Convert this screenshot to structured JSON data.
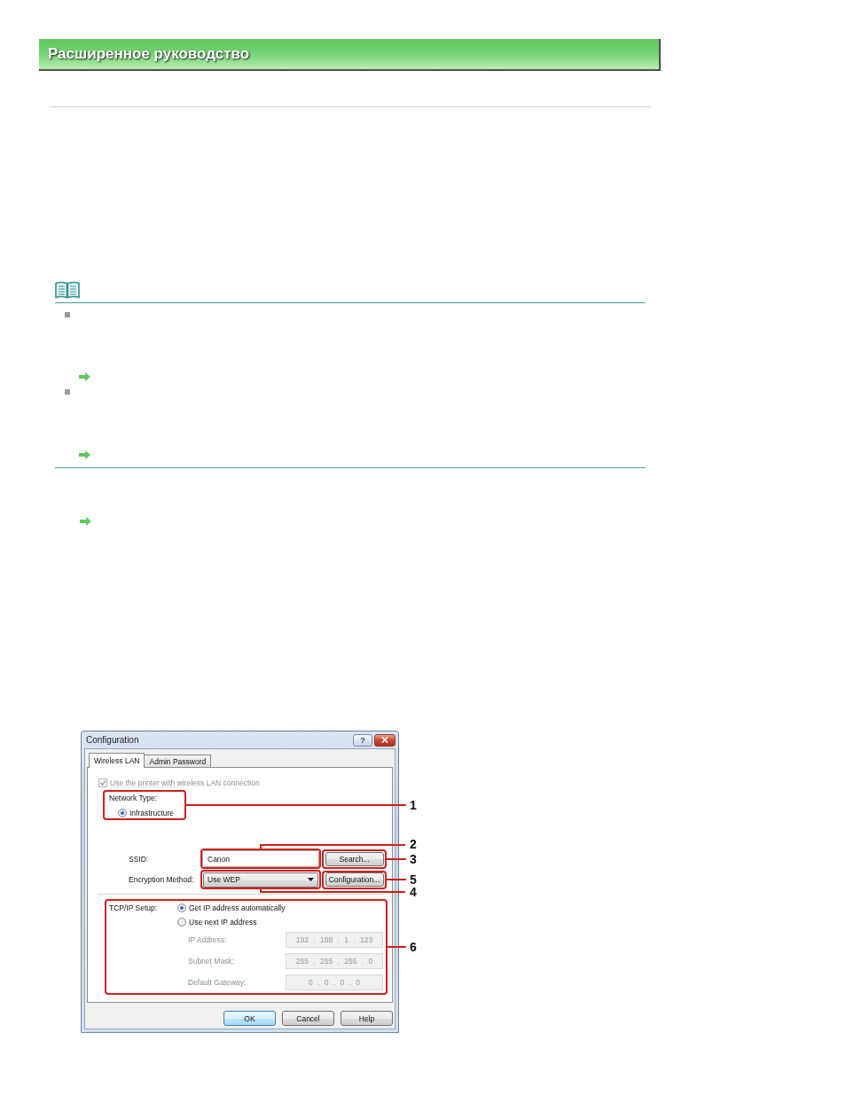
{
  "header": {
    "title": "Расширенное руководство"
  },
  "dialog": {
    "title": "Configuration",
    "help_button": "?",
    "tabs": [
      {
        "label": "Wireless LAN",
        "selected": true
      },
      {
        "label": "Admin Password",
        "selected": false
      }
    ],
    "wireless_checkbox": {
      "label": "Use the printer with wireless LAN connection",
      "checked": true,
      "disabled": true
    },
    "network_type": {
      "label": "Network Type:",
      "options": [
        {
          "label": "Infrastructure",
          "selected": true
        }
      ]
    },
    "ssid": {
      "label": "SSID:",
      "value": "Canon",
      "button": "Search..."
    },
    "encryption": {
      "label": "Encryption Method:",
      "value": "Use WEP",
      "button": "Configuration..."
    },
    "tcpip": {
      "label": "TCP/IP Setup:",
      "options": [
        {
          "label": "Get IP address automatically",
          "selected": true
        },
        {
          "label": "Use next IP address",
          "selected": false
        }
      ],
      "fields": [
        {
          "label": "IP Address:",
          "value": "192 . 168 . 1 . 123",
          "disabled": true
        },
        {
          "label": "Subnet Mask:",
          "value": "255 . 255 . 255 . 0",
          "disabled": true
        },
        {
          "label": "Default Gateway:",
          "value": "0 . 0 . 0 . 0",
          "disabled": true
        }
      ]
    },
    "buttons": [
      {
        "label": "OK",
        "default": true
      },
      {
        "label": "Cancel",
        "default": false
      },
      {
        "label": "Help",
        "default": false
      }
    ]
  },
  "callouts": [
    "1",
    "2",
    "3",
    "5",
    "4",
    "6"
  ]
}
